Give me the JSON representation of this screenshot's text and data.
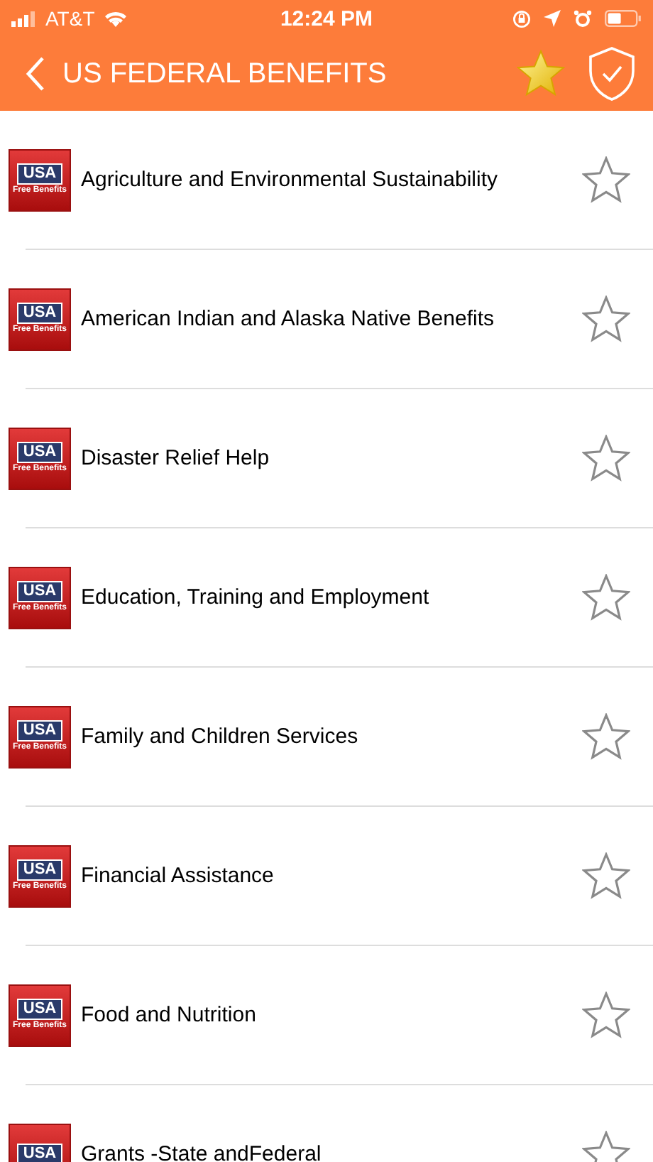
{
  "status_bar": {
    "carrier": "AT&T",
    "time": "12:24 PM"
  },
  "nav": {
    "title": "US FEDERAL BENEFITS"
  },
  "items": [
    {
      "label": "Agriculture and Environmental Sustainability",
      "logo": "USA",
      "logo_sub": "Free Benefits",
      "favorite": false
    },
    {
      "label": "American Indian and Alaska Native Benefits",
      "logo": "USA",
      "logo_sub": "Free Benefits",
      "favorite": false
    },
    {
      "label": "Disaster Relief Help",
      "logo": "USA",
      "logo_sub": "Free Benefits",
      "favorite": false
    },
    {
      "label": "Education, Training and Employment",
      "logo": "USA",
      "logo_sub": "Free Benefits",
      "favorite": false
    },
    {
      "label": "Family and Children Services",
      "logo": "USA",
      "logo_sub": "Free Benefits",
      "favorite": false
    },
    {
      "label": "Financial Assistance",
      "logo": "USA",
      "logo_sub": "Free Benefits",
      "favorite": false
    },
    {
      "label": "Food and Nutrition",
      "logo": "USA",
      "logo_sub": "Free Benefits",
      "favorite": false
    },
    {
      "label": "Grants -State andFederal",
      "logo": "USA",
      "favorite": false
    }
  ]
}
